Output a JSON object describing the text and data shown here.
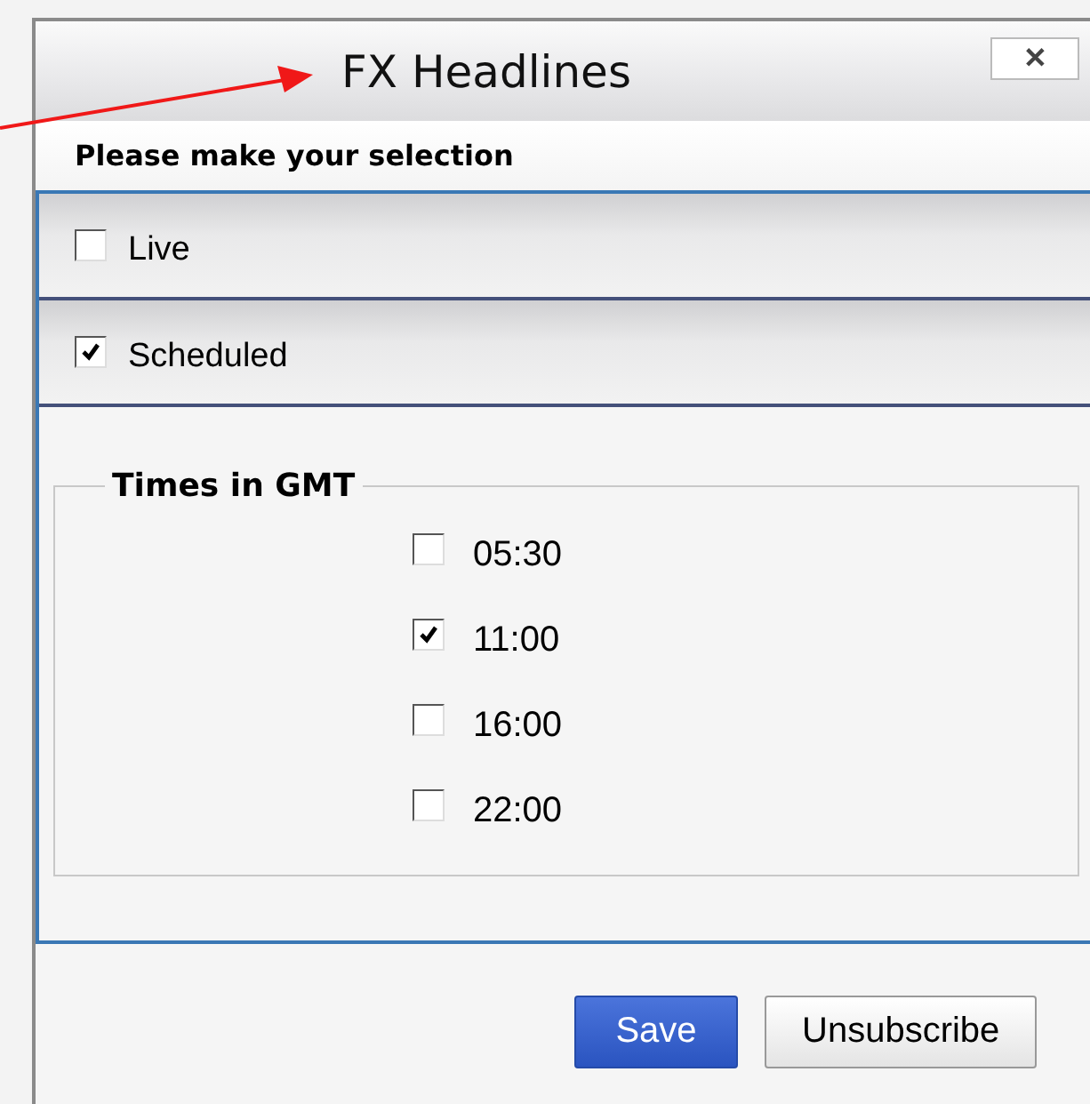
{
  "window": {
    "title": "FX Headlines",
    "close": "✕"
  },
  "prompt": "Please make your selection",
  "options": [
    {
      "label": "Live",
      "checked": false
    },
    {
      "label": "Scheduled",
      "checked": true
    }
  ],
  "times": {
    "legend": "Times in GMT",
    "items": [
      {
        "label": "05:30",
        "checked": false
      },
      {
        "label": "11:00",
        "checked": true
      },
      {
        "label": "16:00",
        "checked": false
      },
      {
        "label": "22:00",
        "checked": false
      }
    ]
  },
  "buttons": [
    {
      "label": "Save",
      "kind": "primary"
    },
    {
      "label": "Unsubscribe",
      "kind": "secondary"
    }
  ]
}
